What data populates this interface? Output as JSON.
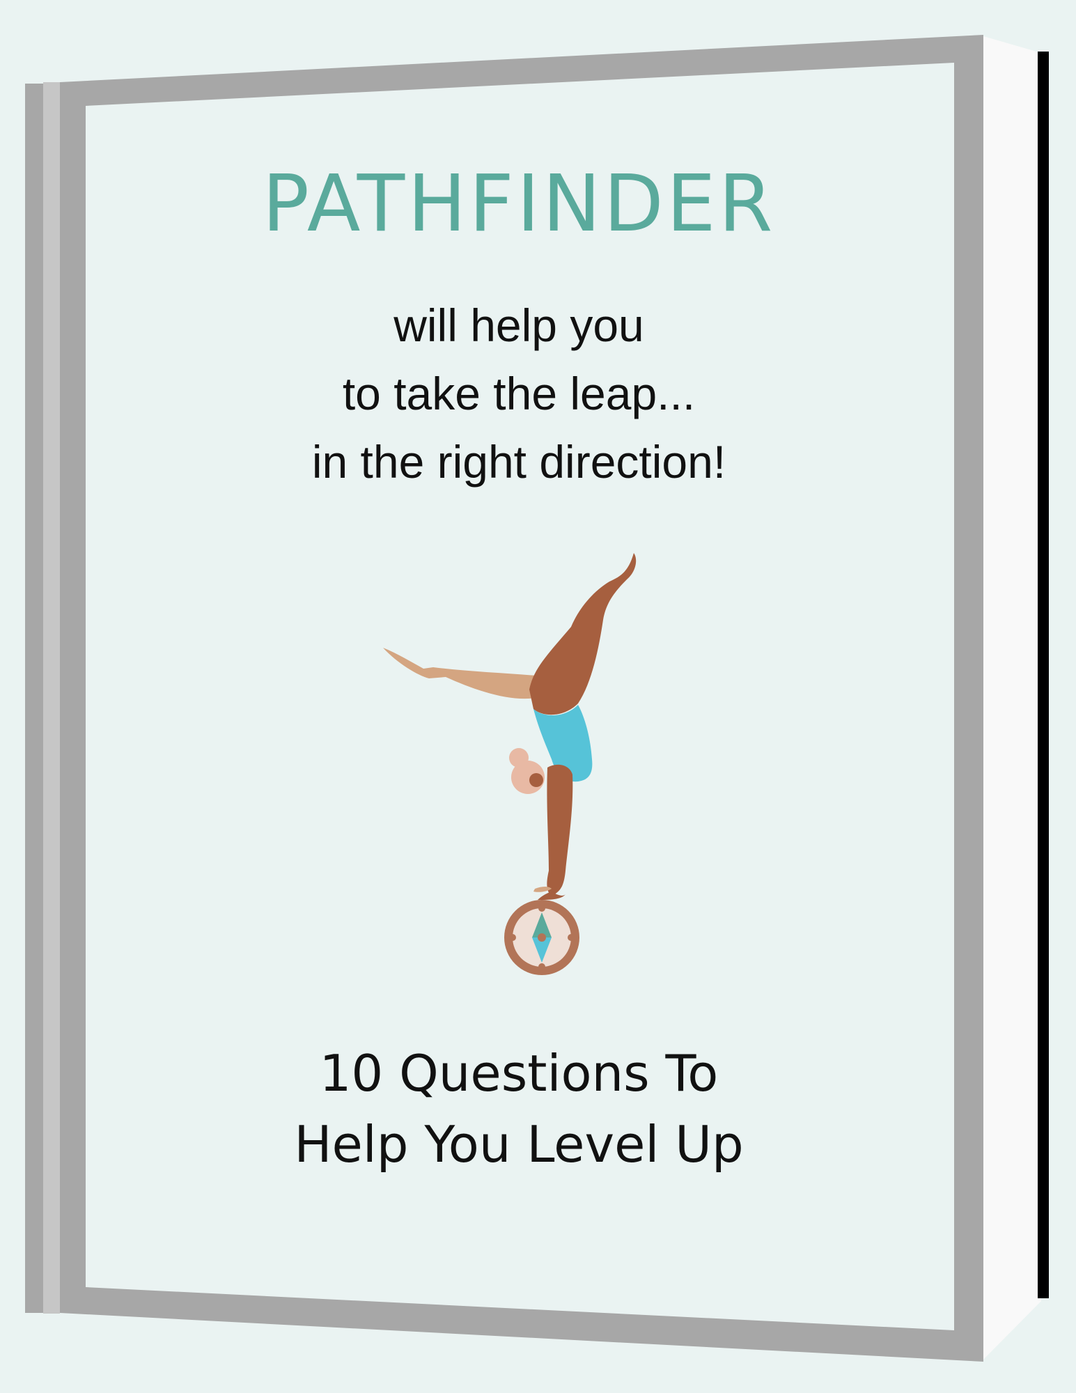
{
  "cover": {
    "title": "PATHFINDER",
    "tagline": [
      "will help you",
      "to take the leap...",
      "in the right direction!"
    ],
    "subtitle": [
      "10 Questions To",
      "Help You Level Up"
    ]
  },
  "colors": {
    "background": "#eaf3f2",
    "title": "#5aaa9c",
    "frame": "#a7a7a7",
    "text": "#111111",
    "compass": "#b27457",
    "leotard": "#56c3d8",
    "skin_dark": "#a65f3f",
    "skin_light": "#d4a581"
  },
  "icons": [
    "gymnast-illustration",
    "compass-icon"
  ]
}
